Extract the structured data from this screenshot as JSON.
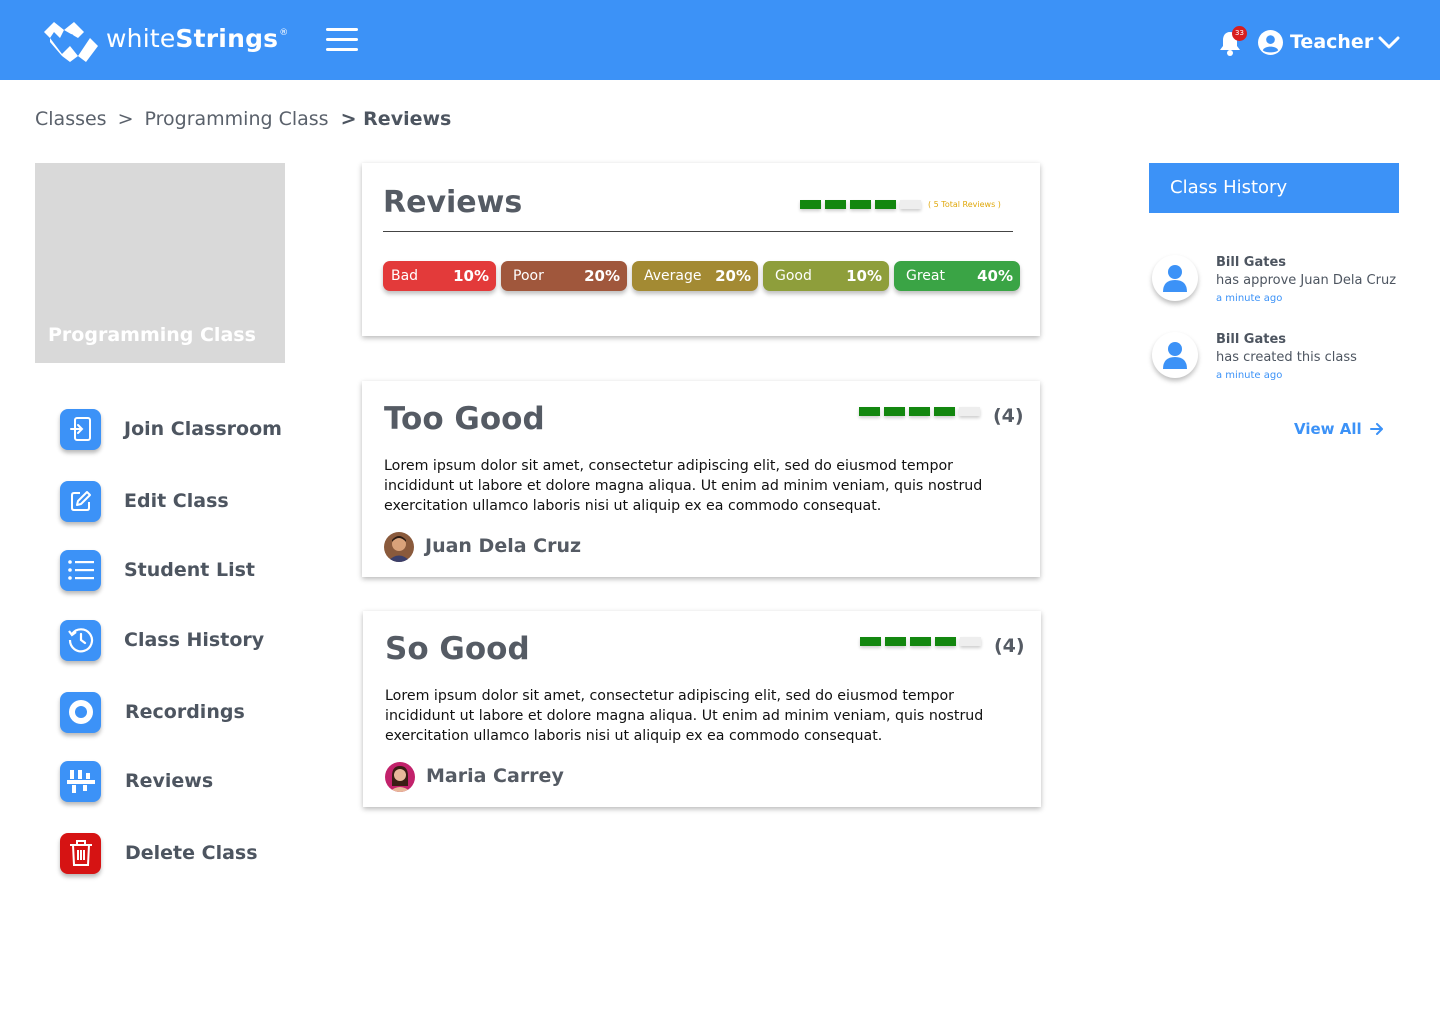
{
  "app": {
    "brand_light": "white",
    "brand_bold": "Strings",
    "brand_mark": "®",
    "accent": "#3c92f7"
  },
  "header": {
    "notification_count": "33",
    "user_name": "Teacher",
    "icons": [
      "logo-icon",
      "menu-icon",
      "bell-icon",
      "user-circle-icon",
      "chevron-down-icon"
    ]
  },
  "breadcrumb": {
    "items": [
      "Classes",
      "Programming Class"
    ],
    "separator": ">",
    "current": "> Reviews"
  },
  "class_card": {
    "title": "Programming Class"
  },
  "sidebar": {
    "items": [
      {
        "label": "Join Classroom",
        "icon": "login-icon"
      },
      {
        "label": "Edit Class",
        "icon": "edit-icon"
      },
      {
        "label": "Student List",
        "icon": "list-icon"
      },
      {
        "label": "Class History",
        "icon": "history-icon"
      },
      {
        "label": "Recordings",
        "icon": "record-icon"
      },
      {
        "label": "Reviews",
        "icon": "reviews-icon"
      },
      {
        "label": "Delete Class",
        "icon": "trash-icon"
      }
    ]
  },
  "summary": {
    "title": "Reviews",
    "rating_filled": 4,
    "rating_max": 5,
    "total_text": "( 5 Total Reviews )",
    "breakdown": [
      {
        "label": "Bad",
        "pct": "10%",
        "color": "#e33a3a"
      },
      {
        "label": "Poor",
        "pct": "20%",
        "color": "#a0573c"
      },
      {
        "label": "Average",
        "pct": "20%",
        "color": "#a38a33"
      },
      {
        "label": "Good",
        "pct": "10%",
        "color": "#8e9e3b"
      },
      {
        "label": "Great",
        "pct": "40%",
        "color": "#3aa445"
      }
    ]
  },
  "reviews": [
    {
      "title": "Too Good",
      "rating_filled": 4,
      "rating_max": 5,
      "count": "(4)",
      "body": "Lorem ipsum dolor sit amet, consectetur adipiscing elit, sed do eiusmod tempor incididunt ut labore et dolore magna aliqua. Ut enim ad minim veniam, quis nostrud exercitation ullamco laboris nisi ut aliquip ex ea commodo consequat.",
      "author": "Juan Dela Cruz"
    },
    {
      "title": "So Good",
      "rating_filled": 4,
      "rating_max": 5,
      "count": "(4)",
      "body": "Lorem ipsum dolor sit amet, consectetur adipiscing elit, sed do eiusmod tempor incididunt ut labore et dolore magna aliqua. Ut enim ad minim veniam, quis nostrud exercitation ullamco laboris nisi ut aliquip ex ea commodo consequat.",
      "author": "Maria Carrey"
    }
  ],
  "history": {
    "title": "Class History",
    "items": [
      {
        "name": "Bill Gates",
        "action": "has approve Juan Dela Cruz",
        "time": "a minute ago"
      },
      {
        "name": "Bill Gates",
        "action": "has created this class",
        "time": "a minute ago"
      }
    ],
    "view_all": "View All"
  }
}
